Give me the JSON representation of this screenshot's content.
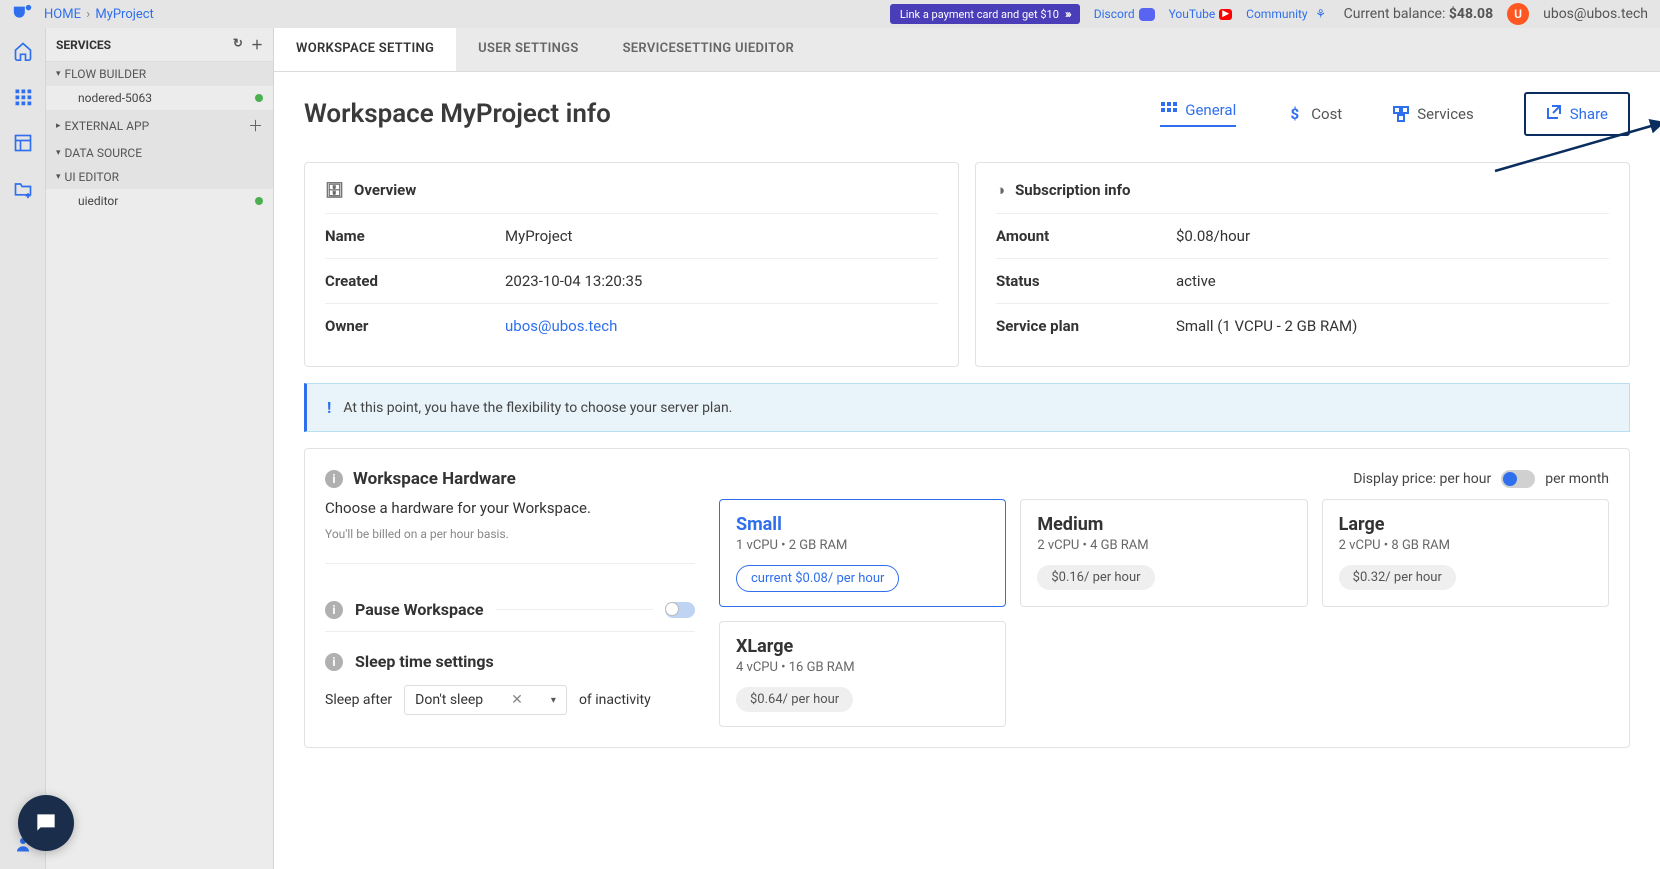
{
  "breadcrumb": {
    "home": "HOME",
    "project": "MyProject"
  },
  "topbar": {
    "promo": "Link a payment card and get $10",
    "discord": "Discord",
    "youtube": "YouTube",
    "community": "Community",
    "balance_label": "Current balance:",
    "balance_value": "$48.08",
    "avatar_initial": "U",
    "user_email": "ubos@ubos.tech"
  },
  "sidebar": {
    "title": "SERVICES",
    "groups": {
      "flow": "FLOW BUILDER",
      "flow_item": "nodered-5063",
      "ext": "EXTERNAL APP",
      "ds": "DATA SOURCE",
      "ui": "UI EDITOR",
      "ui_item": "uieditor"
    }
  },
  "tabs": {
    "t0": "WORKSPACE SETTING",
    "t1": "USER SETTINGS",
    "t2": "SERVICESETTING UIEDITOR"
  },
  "page": {
    "title": "Workspace MyProject info",
    "actions": {
      "general": "General",
      "cost": "Cost",
      "services": "Services",
      "share": "Share"
    }
  },
  "overview": {
    "heading": "Overview",
    "name_k": "Name",
    "name_v": "MyProject",
    "created_k": "Created",
    "created_v": "2023-10-04 13:20:35",
    "owner_k": "Owner",
    "owner_v": "ubos@ubos.tech"
  },
  "subscription": {
    "heading": "Subscription info",
    "amount_k": "Amount",
    "amount_v": "$0.08/hour",
    "status_k": "Status",
    "status_v": "active",
    "plan_k": "Service plan",
    "plan_v": "Small (1 VCPU - 2 GB RAM)"
  },
  "banner": "At this point, you have the flexibility to choose your server plan.",
  "hardware": {
    "title": "Workspace Hardware",
    "desc": "Choose a hardware for your Workspace.",
    "subdesc": "You'll be billed on a per hour basis.",
    "price_label_left": "Display price: per hour",
    "price_label_right": "per month",
    "pause": "Pause Workspace",
    "sleep_title": "Sleep time settings",
    "sleep_after": "Sleep after",
    "sleep_value": "Don't sleep",
    "sleep_suffix": "of inactivity",
    "cards": {
      "small": {
        "name": "Small",
        "spec": "1 vCPU • 2 GB RAM",
        "price": "current $0.08/ per hour"
      },
      "medium": {
        "name": "Medium",
        "spec": "2 vCPU • 4 GB RAM",
        "price": "$0.16/ per hour"
      },
      "large": {
        "name": "Large",
        "spec": "2 vCPU • 8 GB RAM",
        "price": "$0.32/ per hour"
      },
      "xlarge": {
        "name": "XLarge",
        "spec": "4 vCPU • 16 GB RAM",
        "price": "$0.64/ per hour"
      }
    }
  }
}
